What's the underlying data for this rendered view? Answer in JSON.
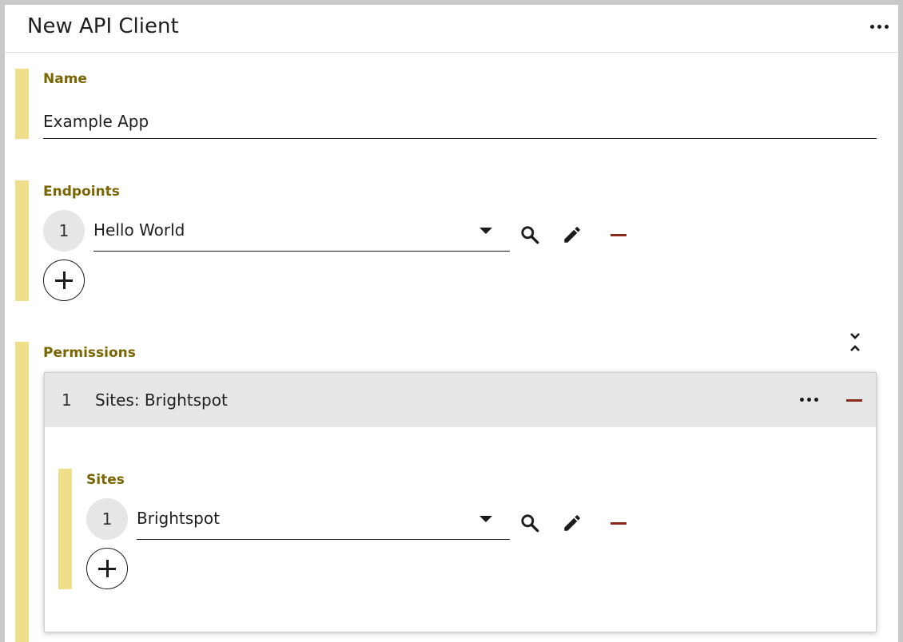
{
  "header": {
    "title": "New API Client",
    "menu_icon": "more-horizontal-icon"
  },
  "name_field": {
    "label": "Name",
    "value": "Example App"
  },
  "endpoints": {
    "label": "Endpoints",
    "items": [
      {
        "ordinal": "1",
        "value": "Hello World"
      }
    ],
    "icons": [
      "dropdown-caret-icon",
      "search-icon",
      "pencil-icon",
      "minus-icon",
      "plus-icon"
    ]
  },
  "permissions": {
    "label": "Permissions",
    "collapse_icon": "collapse-vertical-icon",
    "items": [
      {
        "ordinal": "1",
        "title": "Sites: Brightspot",
        "sites": {
          "label": "Sites",
          "items": [
            {
              "ordinal": "1",
              "value": "Brightspot"
            }
          ]
        }
      }
    ]
  },
  "colors": {
    "accent_bar": "#f0df8a",
    "label_text": "#7a6500",
    "remove_red": "#8b2a1a",
    "card_header_bg": "#e7e7e7"
  }
}
